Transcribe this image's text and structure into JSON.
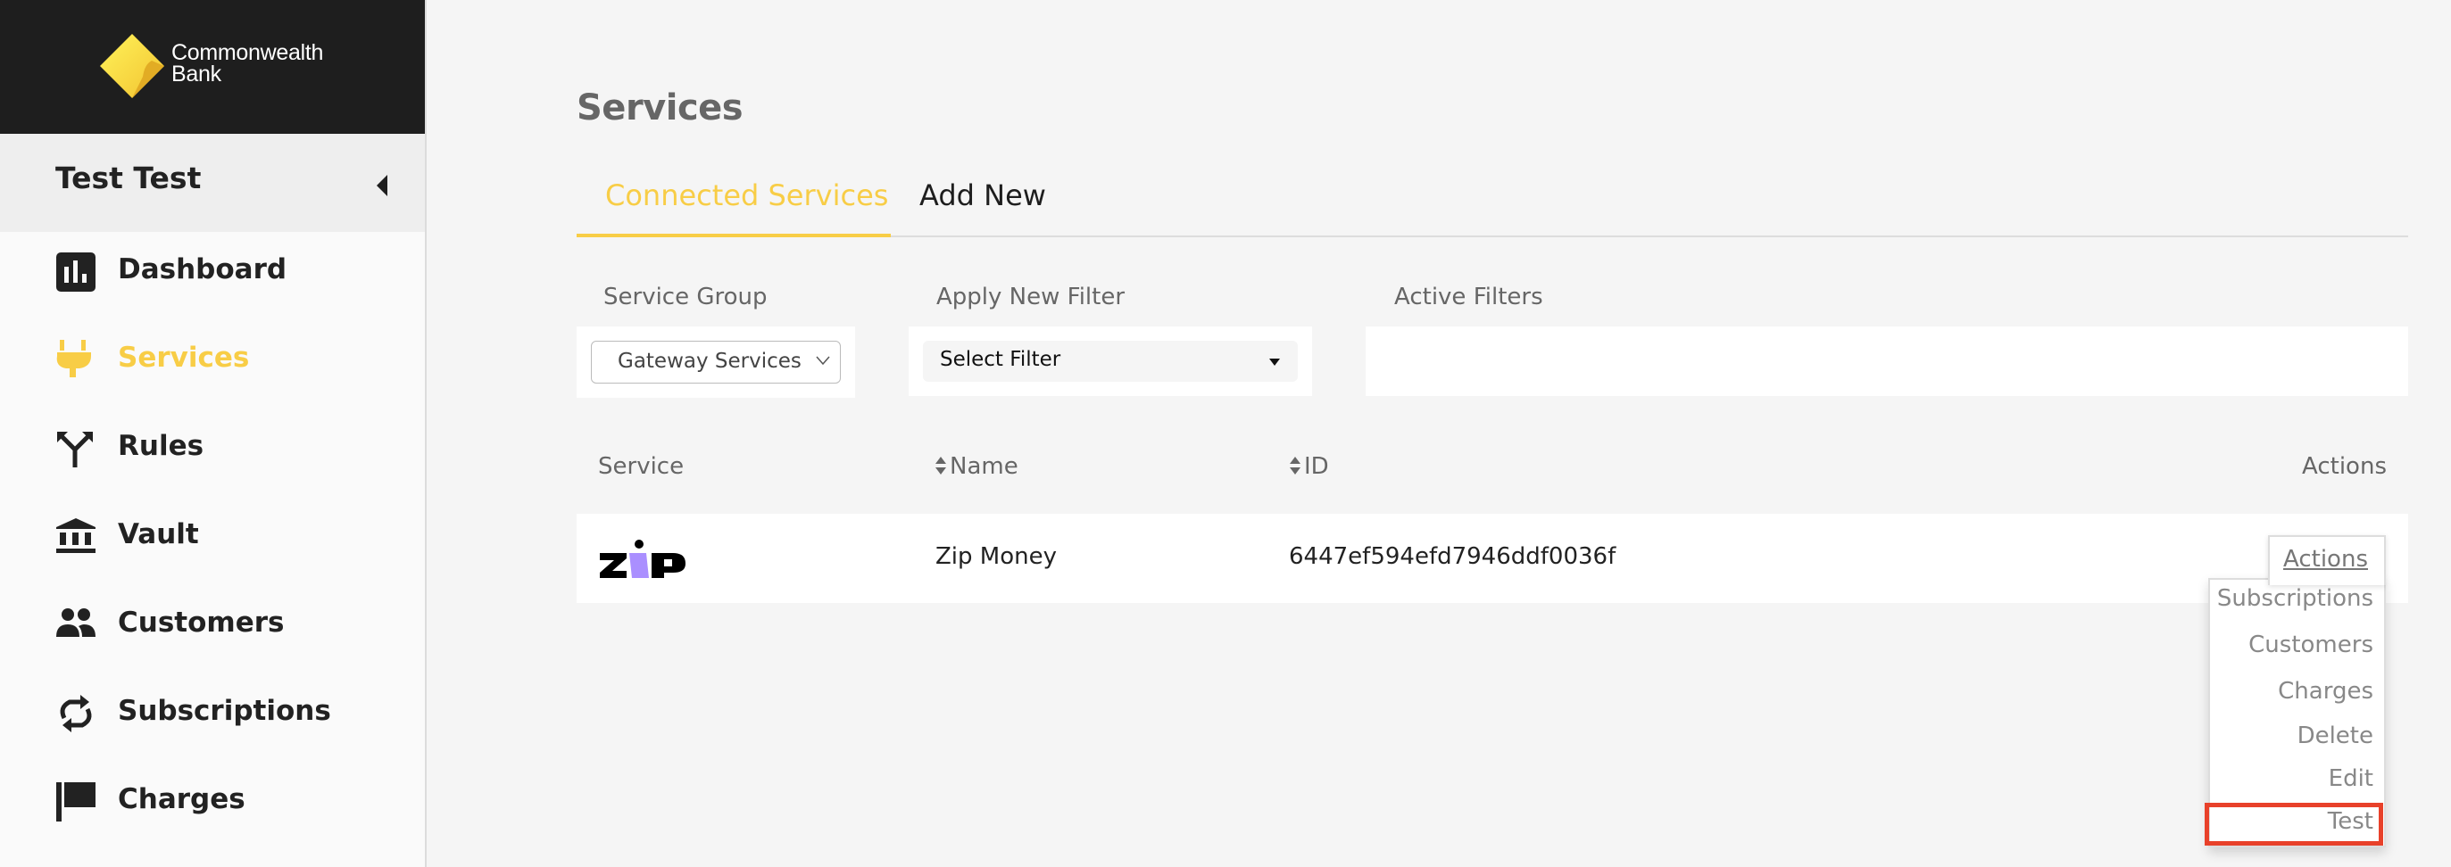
{
  "brand": {
    "line1": "Commonwealth",
    "line2": "Bank",
    "color": "#f8cd46"
  },
  "user": {
    "name": "Test Test"
  },
  "sidebar": {
    "items": [
      {
        "label": "Dashboard",
        "icon": "bar-chart-icon",
        "active": false
      },
      {
        "label": "Services",
        "icon": "plug-icon",
        "active": true
      },
      {
        "label": "Rules",
        "icon": "fork-icon",
        "active": false
      },
      {
        "label": "Vault",
        "icon": "bank-icon",
        "active": false
      },
      {
        "label": "Customers",
        "icon": "people-icon",
        "active": false
      },
      {
        "label": "Subscriptions",
        "icon": "sync-icon",
        "active": false
      },
      {
        "label": "Charges",
        "icon": "flag-icon",
        "active": false
      }
    ]
  },
  "page": {
    "title": "Services"
  },
  "tabs": [
    {
      "label": "Connected Services",
      "active": true
    },
    {
      "label": "Add New",
      "active": false
    }
  ],
  "filters": {
    "service_group_label": "Service Group",
    "service_group_value": "Gateway Services",
    "apply_label": "Apply New Filter",
    "apply_value": "Select Filter",
    "active_label": "Active Filters",
    "active_values": []
  },
  "table": {
    "columns": [
      "Service",
      "Name",
      "ID",
      "Actions"
    ],
    "rows": [
      {
        "service_logo": "zip",
        "name": "Zip Money",
        "id": "6447ef594efd7946ddf0036f"
      }
    ]
  },
  "actions_menu": {
    "button_label": "Actions",
    "items": [
      "Subscriptions",
      "Customers",
      "Charges",
      "Delete",
      "Edit",
      "Test"
    ],
    "highlighted": "Test",
    "highlight_color": "#e8412a"
  }
}
